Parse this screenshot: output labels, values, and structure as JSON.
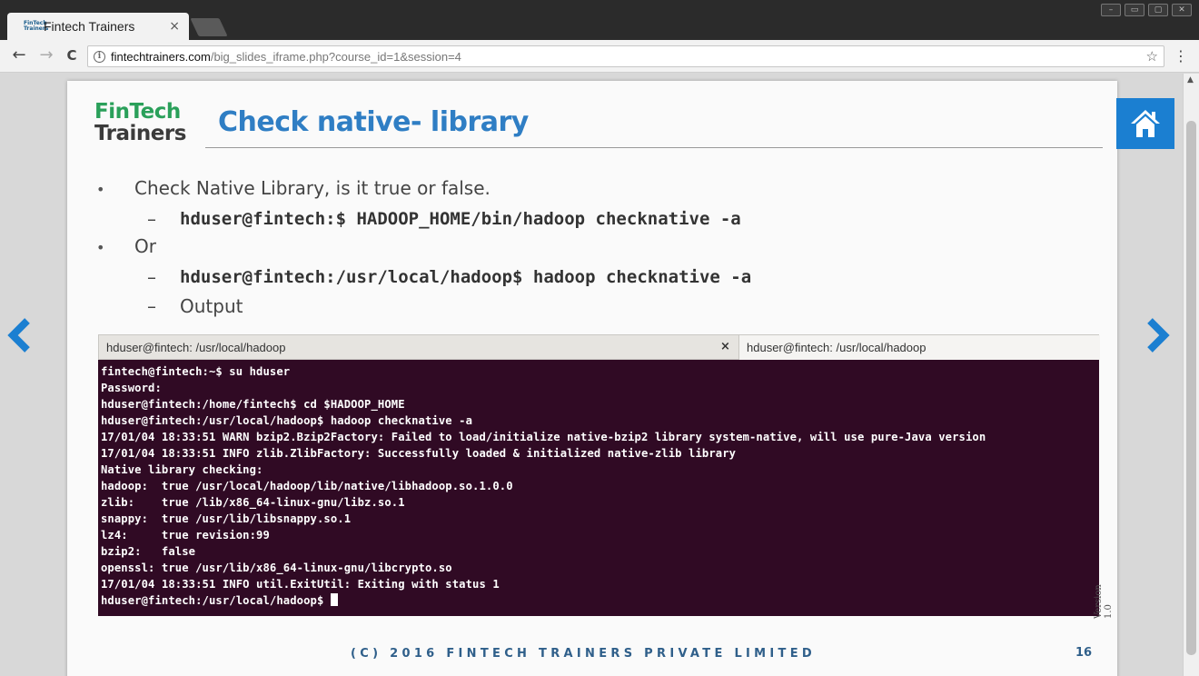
{
  "browser": {
    "tab_title": "Fintech Trainers",
    "tab_close": "×",
    "favicon_text": "FinTech Trainers",
    "url_host": "fintechtrainers.com",
    "url_path": "/big_slides_iframe.php?course_id=1&session=4",
    "back": "←",
    "forward": "→",
    "reload": "C",
    "star": "☆",
    "menu": "⋮"
  },
  "slide": {
    "logo_line1": "FinTech",
    "logo_line2": "Trainers",
    "title": "Check native- library",
    "bullet1": "Check Native Library, is it true or false.",
    "cmd1": "hduser@fintech:$ HADOOP_HOME/bin/hadoop checknative -a",
    "bullet2": "Or",
    "cmd2": "hduser@fintech:/usr/local/hadoop$ hadoop checknative -a",
    "sub3": "Output",
    "bullet_symbol": "•",
    "dash_symbol": "–",
    "footer": "(C) 2016 FINTECH TRAINERS PRIVATE LIMITED",
    "page_number": "16",
    "version": "Version 1.0"
  },
  "terminal": {
    "tab1_title": "hduser@fintech: /usr/local/hadoop",
    "tab_close": "×",
    "tab2_title": "hduser@fintech: /usr/local/hadoop",
    "lines": [
      "fintech@fintech:~$ su hduser",
      "Password:",
      "hduser@fintech:/home/fintech$ cd $HADOOP_HOME",
      "hduser@fintech:/usr/local/hadoop$ hadoop checknative -a",
      "17/01/04 18:33:51 WARN bzip2.Bzip2Factory: Failed to load/initialize native-bzip2 library system-native, will use pure-Java version",
      "17/01/04 18:33:51 INFO zlib.ZlibFactory: Successfully loaded & initialized native-zlib library",
      "Native library checking:",
      "hadoop:  true /usr/local/hadoop/lib/native/libhadoop.so.1.0.0",
      "zlib:    true /lib/x86_64-linux-gnu/libz.so.1",
      "snappy:  true /usr/lib/libsnappy.so.1",
      "lz4:     true revision:99",
      "bzip2:   false",
      "openssl: true /usr/lib/x86_64-linux-gnu/libcrypto.so",
      "17/01/04 18:33:51 INFO util.ExitUtil: Exiting with status 1",
      "hduser@fintech:/usr/local/hadoop$ "
    ]
  },
  "colors": {
    "title_blue": "#2f7ec4",
    "logo_green": "#2aa05a",
    "terminal_bg": "#300a24",
    "home_button": "#1b7fd1",
    "arrow_blue": "#1b7fd1"
  }
}
